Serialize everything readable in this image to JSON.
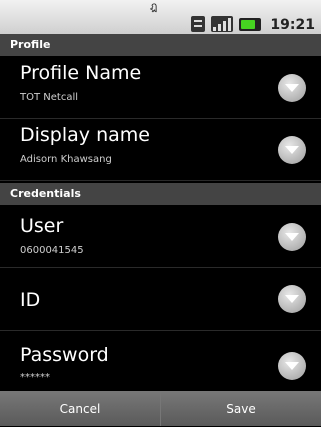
{
  "statusbar": {
    "top_glyph": "ฎ",
    "time": "19:21"
  },
  "sections": {
    "profile": {
      "label": "Profile"
    },
    "credentials": {
      "label": "Credentials"
    }
  },
  "prefs": {
    "profile_name": {
      "title": "Profile Name",
      "summary": "TOT Netcall"
    },
    "display_name": {
      "title": "Display name",
      "summary": "Adisorn Khawsang"
    },
    "user": {
      "title": "User",
      "summary": "0600041545"
    },
    "id": {
      "title": "ID"
    },
    "password": {
      "title": "Password",
      "summary": "******"
    }
  },
  "buttons": {
    "cancel": "Cancel",
    "save": "Save"
  },
  "colors": {
    "battery": "#46d321"
  }
}
